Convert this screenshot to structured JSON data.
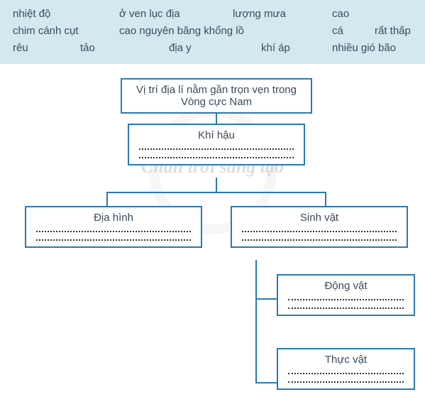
{
  "word_bank": {
    "row1": [
      "nhiệt độ",
      "ở ven lục địa",
      "lượng mưa",
      "cao"
    ],
    "row2": [
      "chim cánh cụt",
      "cao nguyên băng khổng lồ",
      "cá",
      "rất thấp"
    ],
    "row3": [
      "rêu",
      "tảo",
      "địa y",
      "khí áp",
      "nhiều gió bão"
    ]
  },
  "watermark": "Chân trời sáng tạo",
  "nodes": {
    "root": "Vị trí địa lí nằm gần trọn vẹn trong Vòng cực Nam",
    "climate": "Khí hậu",
    "terrain": "Địa hình",
    "organisms": "Sinh vật",
    "animals": "Động vật",
    "plants": "Thực vật"
  }
}
